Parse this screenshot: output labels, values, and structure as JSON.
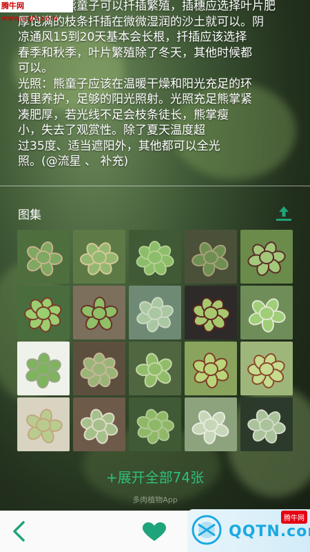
{
  "watermark_top": {
    "brand": "腾牛网",
    "url": "www.qqtn.com"
  },
  "article": {
    "lines": [
      "…繁殖：熊童子可以扦插繁殖，插穗应选择叶片肥",
      "厚饱满的枝条扦插在微微湿润的沙土就可以。阴",
      "凉通风15到20天基本会长根，扦插应该选择",
      "春季和秋季，叶片繁殖除了冬天，其他时候都",
      "可以。",
      "光照：熊童子应该在温暖干燥和阳光充足的环",
      "境里养护，足够的阳光照射。光照充足熊掌紧",
      "凑肥厚，若光线不足会枝条徒长，熊掌瘦",
      "小，失去了观赏性。除了夏天温度超",
      "过35度、适当遮阳外，其他都可以全光",
      "照。(@流星 、 补充)"
    ]
  },
  "gallery": {
    "title": "图集",
    "upload_icon": "upload-icon",
    "expand_label": "+展开全部74张",
    "app_mark": "多肉植物App"
  },
  "thumbs": [
    {
      "bg": "#4e6e3e",
      "leaf": "#7fa862",
      "tip": "#c9b38a"
    },
    {
      "bg": "#5d7a46",
      "leaf": "#94b870",
      "tip": "#d7c79a"
    },
    {
      "bg": "#3f5a35",
      "leaf": "#8bbd6a",
      "tip": "#b5cf92"
    },
    {
      "bg": "#4b5138",
      "leaf": "#6f8f52",
      "tip": "#a9a07a"
    },
    {
      "bg": "#6a8b4a",
      "leaf": "#a4c87a",
      "tip": "#5a2c2a"
    },
    {
      "bg": "#4a6d3e",
      "leaf": "#9ccd6f",
      "tip": "#7a3a2c"
    },
    {
      "bg": "#7c6f5b",
      "leaf": "#8fbf66",
      "tip": "#6b2f28"
    },
    {
      "bg": "#6f8a74",
      "leaf": "#a9c7a0",
      "tip": "#cfd9c6"
    },
    {
      "bg": "#2f2a2a",
      "leaf": "#a7c86e",
      "tip": "#5b2320"
    },
    {
      "bg": "#6f8d58",
      "leaf": "#9fcd78",
      "tip": "#dfe7d2"
    },
    {
      "bg": "#eef2ea",
      "leaf": "#7fb45e",
      "tip": "#9aa588"
    },
    {
      "bg": "#5d4f3e",
      "leaf": "#9ab478",
      "tip": "#c8b89a"
    },
    {
      "bg": "#4f6640",
      "leaf": "#91bd6b",
      "tip": "#c6d6a8"
    },
    {
      "bg": "#8aa35d",
      "leaf": "#b9d47a",
      "tip": "#7f3a26"
    },
    {
      "bg": "#9fb67a",
      "leaf": "#c7dc8f",
      "tip": "#8a4a2c"
    },
    {
      "bg": "#d9d3c1",
      "leaf": "#b9cc90",
      "tip": "#c2a77e"
    },
    {
      "bg": "#6d5a48",
      "leaf": "#a6c08b",
      "tip": "#e2dbc9"
    },
    {
      "bg": "#3f5a34",
      "leaf": "#8fb866",
      "tip": "#b2c99a"
    },
    {
      "bg": "#8da37e",
      "leaf": "#c7d6b8",
      "tip": "#e8ede0"
    },
    {
      "bg": "#2c3a2b",
      "leaf": "#a9c29a",
      "tip": "#d5dccc"
    }
  ],
  "bottom_bar": {
    "back_icon": "chevron-left-icon",
    "favorite_icon": "heart-icon"
  },
  "watermark_bottom": {
    "text": "QQTN.com",
    "badge": "腾牛网"
  },
  "colors": {
    "accent": "#2fbf7b",
    "icon": "#1fa37a"
  }
}
